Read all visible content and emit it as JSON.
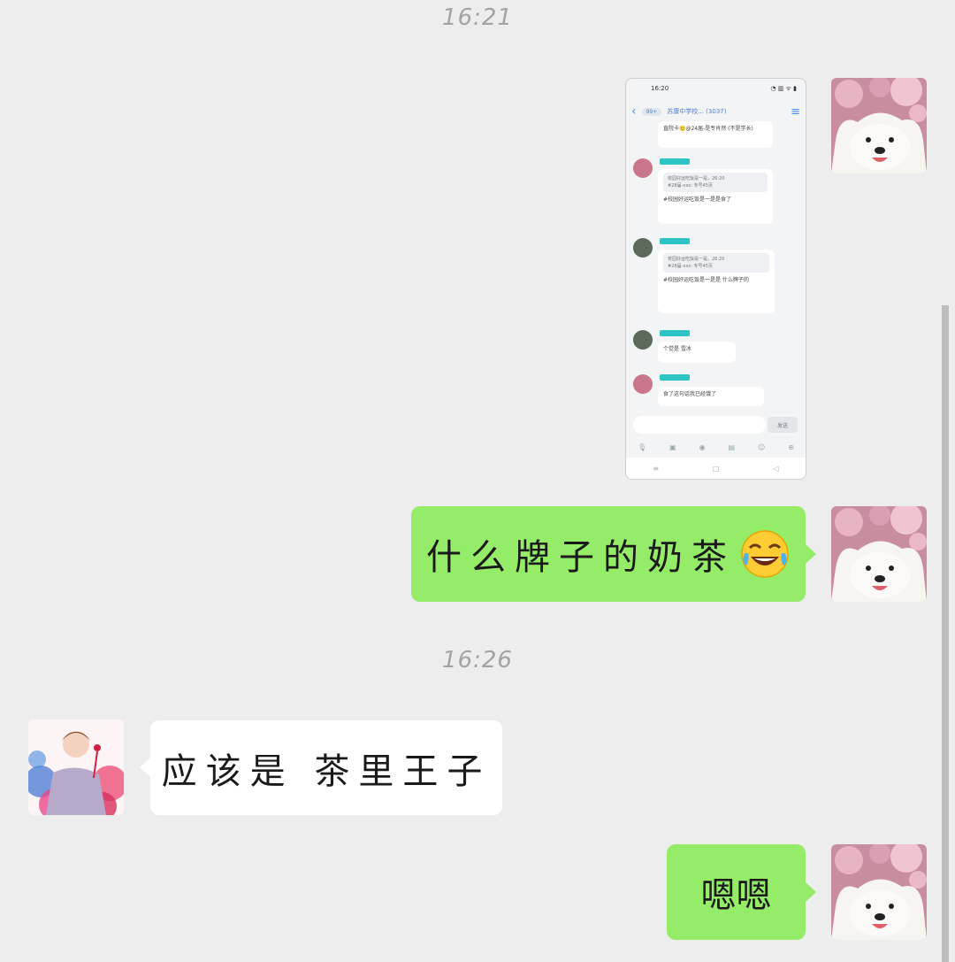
{
  "timestamps": [
    "16:21",
    "16:26"
  ],
  "messages": {
    "m1_text": "什么牌子的奶茶",
    "m1_emoji": "face-with-tears-of-joy",
    "m2_text": "应该是 茶里王子",
    "m3_text": "嗯嗯"
  },
  "embedded_screenshot": {
    "status_time": "16:20",
    "group_title": "苏康中学校... (3037)",
    "back_pill": "99+",
    "msg1_text": "直院卡🙂@24届-是专肖然 (不是学长)",
    "msg2_quote_line1": "校园好运吃饭是一是，26:20",
    "msg2_quote_line2": "#28届-xxx: 专号45页",
    "msg2_text": "#校园好运吃饭是一是是食了",
    "msg3_quote_line1": "校园好运吃饭是一是，26:20",
    "msg3_quote_line2": "#28届-xxx: 专号45页",
    "msg3_text": "#校园好运吃饭是一是是 什么牌子的",
    "msg4_text": "个觉是 雪冰",
    "msg5_text": "食了这句话我已经饿了",
    "send_label": "发送"
  },
  "colors": {
    "background": "#ededed",
    "self_bubble": "#95ec69",
    "other_bubble": "#ffffff",
    "timestamp": "#a3a3a3"
  }
}
